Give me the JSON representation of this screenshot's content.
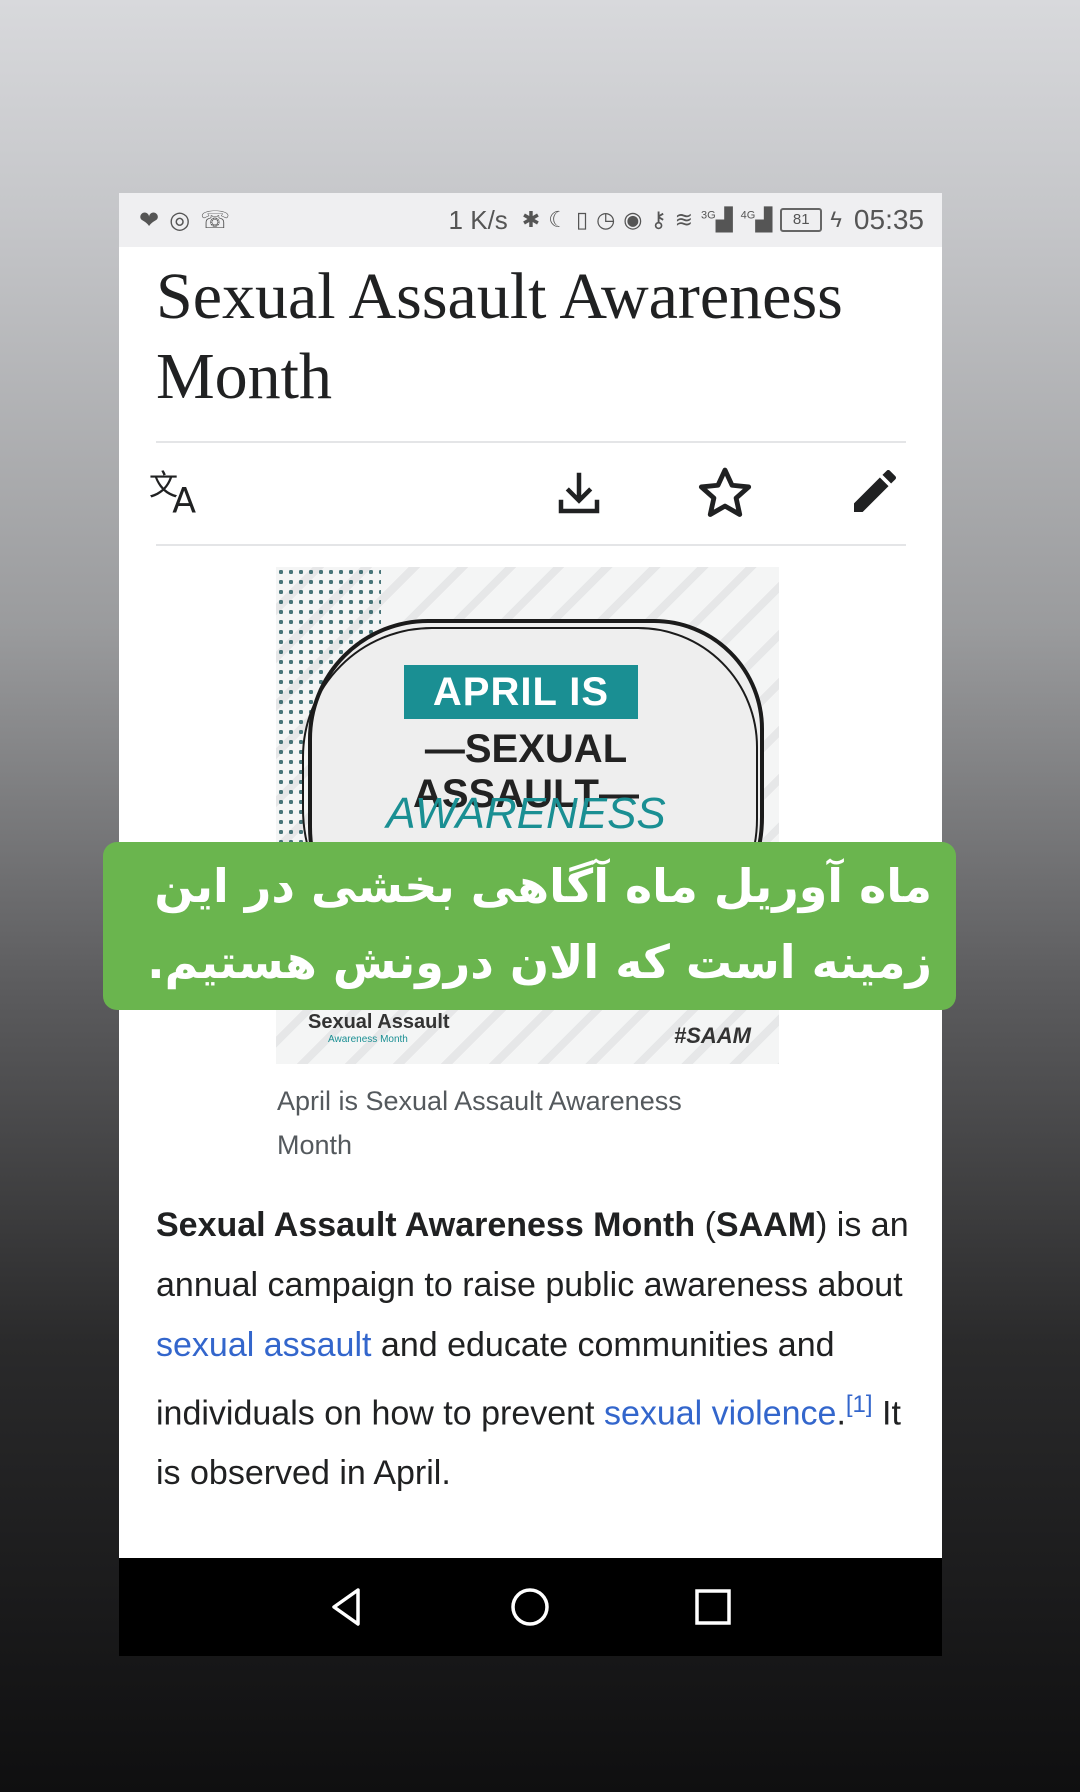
{
  "statusbar": {
    "left_icons": [
      "heart-pulse-icon",
      "instagram-icon",
      "missed-call-icon"
    ],
    "speed": "1 K/s",
    "network_3g": "3G",
    "network_4g": "4G",
    "battery": "81",
    "time": "05:35"
  },
  "article": {
    "title": "Sexual Assault Awareness Month",
    "toolbar": {
      "language_icon": "translate-icon",
      "download_icon": "download-icon",
      "watch_icon": "star-icon",
      "edit_icon": "pencil-icon"
    },
    "hero_image": {
      "line1": "APRIL IS",
      "line2": "—SEXUAL ASSAULT—",
      "line3": "AWARENESS MONTH",
      "logo": "Sexual Assault",
      "logo_sub": "Awareness Month",
      "hashtag": "#SAAM",
      "accent": "#1a8f93"
    },
    "caption": "April is Sexual Assault Awareness Month",
    "body": {
      "bold_term": "Sexual Assault Awareness Month",
      "paren_open": " (",
      "abbr": "SAAM",
      "text1": ") is an annual campaign to raise public awareness about ",
      "link1": "sexual assault",
      "text2": " and educate communities and individuals on how to prevent ",
      "link2": "sexual violence",
      "text3": ".",
      "ref": "[1]",
      "text4": " It is observed in April."
    }
  },
  "overlay": {
    "text": "ماه آوریل ماه آگاهی بخشی در این زمینه است که الان درونش هستیم.",
    "background": "#6ab54e"
  },
  "navbar": {
    "back_icon": "back-triangle-icon",
    "home_icon": "home-circle-icon",
    "recents_icon": "recents-square-icon"
  }
}
